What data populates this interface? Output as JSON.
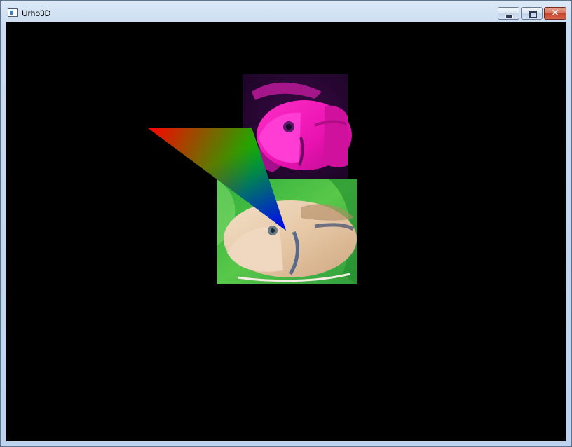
{
  "window": {
    "title": "Urho3D",
    "icon": "app-window-icon"
  },
  "controls": {
    "minimize": "minimize-icon",
    "maximize": "maximize-icon",
    "close": "close-icon",
    "close_glyph": "✕"
  },
  "scene": {
    "background": "#000000",
    "triangle_colors": [
      "#ff0000",
      "#00c000",
      "#0000ff"
    ]
  }
}
